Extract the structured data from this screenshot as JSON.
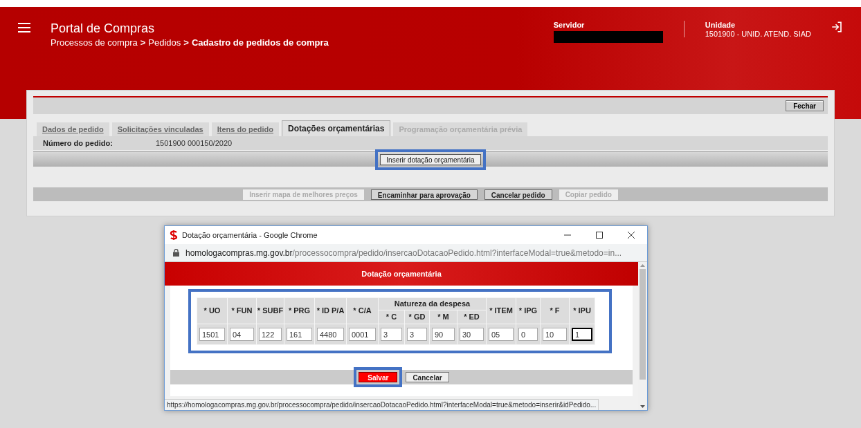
{
  "header": {
    "app_title": "Portal de Compras",
    "breadcrumb": [
      {
        "label": "Processos de compra",
        "current": false
      },
      {
        "label": "Pedidos",
        "current": false
      },
      {
        "label": "Cadastro de pedidos de compra",
        "current": true
      }
    ],
    "separators": [
      ">",
      ">"
    ],
    "servidor_label": "Servidor",
    "unidade_label": "Unidade",
    "unidade_value": "1501900 - UNID. ATEND. SIAD"
  },
  "card": {
    "close_button": "Fechar",
    "tabs": [
      {
        "label": "Dados de pedido",
        "selected": false,
        "disabled": false
      },
      {
        "label": "Solicitações vinculadas",
        "selected": false,
        "disabled": false
      },
      {
        "label": "Itens do pedido",
        "selected": false,
        "disabled": false
      },
      {
        "label": "Dotações orçamentárias",
        "selected": true,
        "disabled": false
      },
      {
        "label": "Programação orçamentária prévia",
        "selected": false,
        "disabled": true
      }
    ],
    "order_number_label": "Número do pedido:",
    "order_number": "1501900 000150/2020",
    "insert_button": {
      "label": "Inserir dotação orçamentária",
      "highlighted": true
    },
    "actions": [
      {
        "label": "Inserir mapa de melhores preços",
        "disabled": true
      },
      {
        "label": "Encaminhar para aprovação",
        "disabled": false
      },
      {
        "label": "Cancelar pedido",
        "disabled": false
      },
      {
        "label": "Copiar pedido",
        "disabled": true
      }
    ]
  },
  "popup": {
    "window_title": "Dotação orçamentária - Google Chrome",
    "url_host": "homologacompras.mg.gov.br",
    "url_path": "/processocompra/pedido/insercaoDotacaoPedido.html?interfaceModal=true&metodo=in...",
    "banner": "Dotação orçamentária",
    "table": {
      "highlighted": true,
      "columns": [
        {
          "kind": "single",
          "label": "* UO"
        },
        {
          "kind": "single",
          "label": "* FUN"
        },
        {
          "kind": "single",
          "label": "* SUBF"
        },
        {
          "kind": "single",
          "label": "* PRG"
        },
        {
          "kind": "single",
          "label": "* ID P/A"
        },
        {
          "kind": "single",
          "label": "* C/A"
        },
        {
          "kind": "group",
          "label": "Natureza da despesa",
          "children": [
            "* C",
            "* GD",
            "* M",
            "* ED"
          ]
        },
        {
          "kind": "single",
          "label": "* ITEM"
        },
        {
          "kind": "single",
          "label": "* IPG"
        },
        {
          "kind": "single",
          "label": "* F"
        },
        {
          "kind": "single",
          "label": "* IPU"
        }
      ],
      "fields": [
        {
          "value": "1501",
          "focused": false
        },
        {
          "value": "04",
          "focused": false
        },
        {
          "value": "122",
          "focused": false
        },
        {
          "value": "161",
          "focused": false
        },
        {
          "value": "4480",
          "focused": false
        },
        {
          "value": "0001",
          "focused": false
        },
        {
          "value": "3",
          "focused": false
        },
        {
          "value": "3",
          "focused": false
        },
        {
          "value": "90",
          "focused": false
        },
        {
          "value": "30",
          "focused": false
        },
        {
          "value": "05",
          "focused": false
        },
        {
          "value": "0",
          "focused": false
        },
        {
          "value": "10",
          "focused": false
        },
        {
          "value": "1",
          "focused": true
        }
      ]
    },
    "save_button": {
      "label": "Salvar",
      "highlighted": true
    },
    "cancel_button": "Cancelar",
    "status_url": "https://homologacompras.mg.gov.br/processocompra/pedido/insercaoDotacaoPedido.html?interfaceModal=true&metodo=inserir&idPedido..."
  }
}
